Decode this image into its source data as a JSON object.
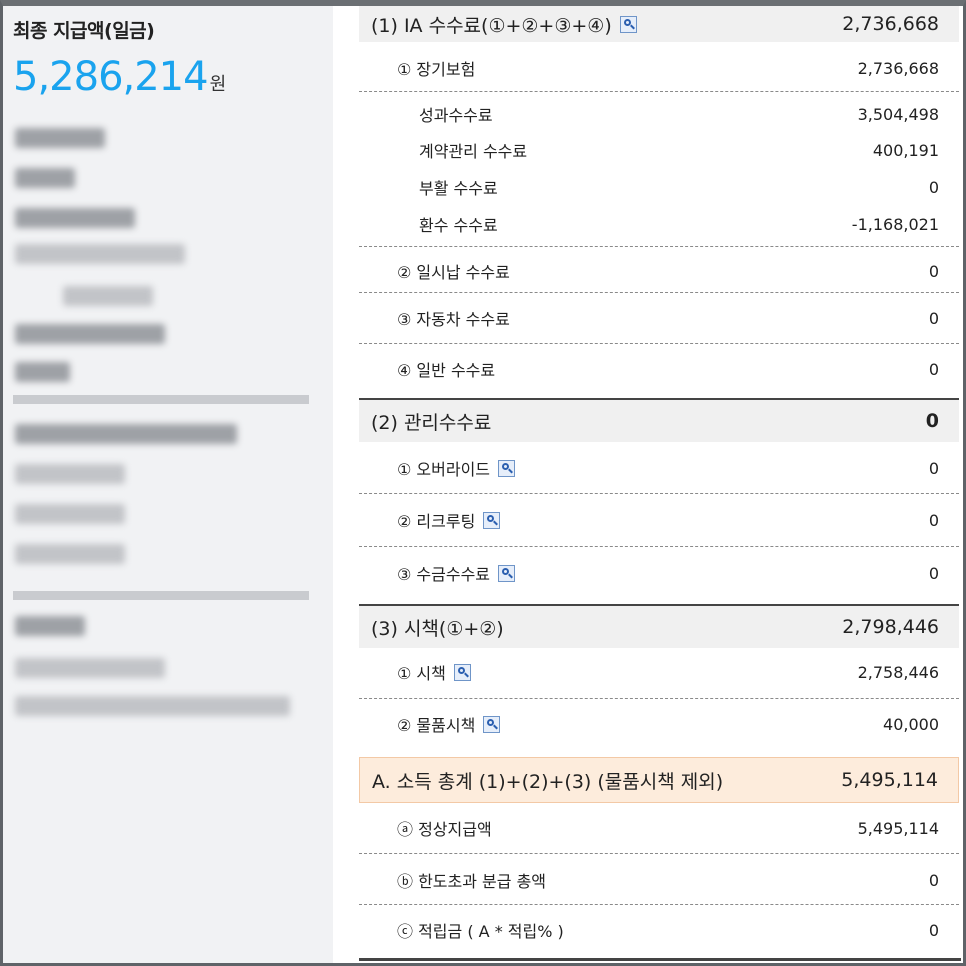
{
  "summary": {
    "title": "최종 지급액(일금)",
    "amount": "5,286,214",
    "unit": "원"
  },
  "commission": {
    "ia": {
      "label": "(1) IA 수수료(①+②+③+④)",
      "value": "2,736,668",
      "items": [
        {
          "label": "① 장기보험",
          "value": "2,736,668"
        },
        {
          "label": "성과수수료",
          "value": "3,504,498"
        },
        {
          "label": "계약관리 수수료",
          "value": "400,191"
        },
        {
          "label": "부활 수수료",
          "value": "0"
        },
        {
          "label": "환수 수수료",
          "value": "-1,168,021"
        },
        {
          "label": "② 일시납 수수료",
          "value": "0"
        },
        {
          "label": "③ 자동차 수수료",
          "value": "0"
        },
        {
          "label": "④ 일반 수수료",
          "value": "0"
        }
      ]
    },
    "management": {
      "label": "(2) 관리수수료",
      "value": "0",
      "items": [
        {
          "label": "① 오버라이드",
          "value": "0"
        },
        {
          "label": "② 리크루팅",
          "value": "0"
        },
        {
          "label": "③ 수금수수료",
          "value": "0"
        }
      ]
    },
    "incentive": {
      "label": "(3) 시책(①+②)",
      "value": "2,798,446",
      "items": [
        {
          "label": "① 시책",
          "value": "2,758,446"
        },
        {
          "label": "② 물품시책",
          "value": "40,000"
        }
      ]
    },
    "total": {
      "label": "A. 소득 총계 (1)+(2)+(3) (물품시책 제외)",
      "value": "5,495,114",
      "items": [
        {
          "label": "ⓐ 정상지급액",
          "value": "5,495,114"
        },
        {
          "label": "ⓑ 한도초과 분급 총액",
          "value": "0"
        },
        {
          "label": "ⓒ 적립금 ( A * 적립% )",
          "value": "0"
        }
      ]
    }
  },
  "icons": {
    "detail": "magnifier-icon"
  },
  "colors": {
    "amount": "#1aa3ee",
    "header_bg": "#f0f0f0",
    "total_bg": "#fdecdc"
  }
}
